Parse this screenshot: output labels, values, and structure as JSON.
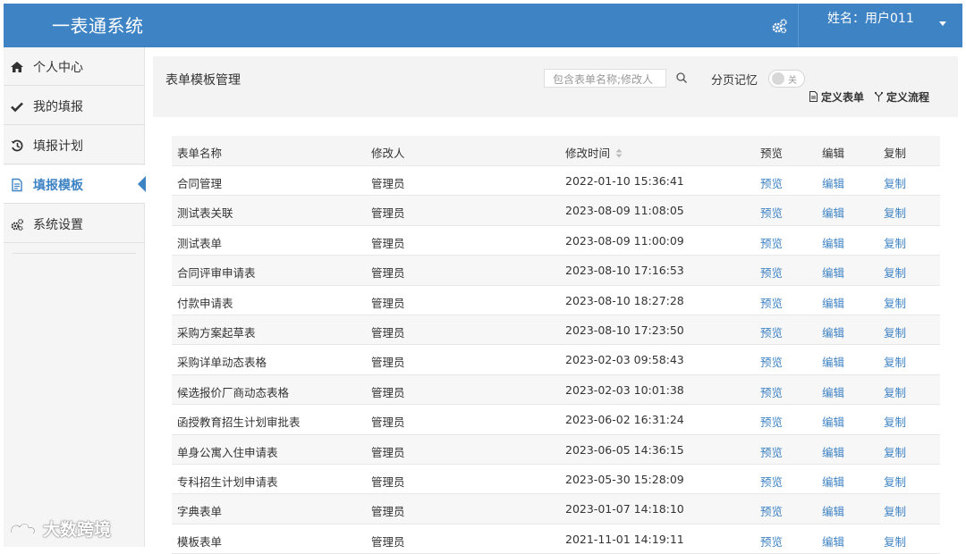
{
  "header": {
    "app_title": "一表通系统",
    "user_label": "姓名：用户011"
  },
  "sidebar": {
    "items": [
      {
        "label": "个人中心",
        "icon": "home-icon"
      },
      {
        "label": "我的填报",
        "icon": "check-icon"
      },
      {
        "label": "填报计划",
        "icon": "history-icon"
      },
      {
        "label": "填报模板",
        "icon": "document-icon",
        "active": true
      },
      {
        "label": "系统设置",
        "icon": "gears-icon"
      }
    ]
  },
  "toolbar": {
    "page_title": "表单模板管理",
    "search_placeholder": "包含表单名称;修改人",
    "page_memory_label": "分页记忆",
    "toggle_text": "关",
    "define_form": "定义表单",
    "define_flow": "定义流程"
  },
  "table": {
    "headers": {
      "name": "表单名称",
      "modifier": "修改人",
      "time": "修改时间",
      "preview": "预览",
      "edit": "编辑",
      "copy": "复制"
    },
    "action_labels": {
      "preview": "预览",
      "edit": "编辑",
      "copy": "复制"
    },
    "rows": [
      {
        "name": "合同管理",
        "modifier": "管理员",
        "time": "2022-01-10 15:36:41"
      },
      {
        "name": "测试表关联",
        "modifier": "管理员",
        "time": "2023-08-09 11:08:05"
      },
      {
        "name": "测试表单",
        "modifier": "管理员",
        "time": "2023-08-09 11:00:09"
      },
      {
        "name": "合同评审申请表",
        "modifier": "管理员",
        "time": "2023-08-10 17:16:53"
      },
      {
        "name": "付款申请表",
        "modifier": "管理员",
        "time": "2023-08-10 18:27:28"
      },
      {
        "name": "采购方案起草表",
        "modifier": "管理员",
        "time": "2023-08-10 17:23:50"
      },
      {
        "name": "采购详单动态表格",
        "modifier": "管理员",
        "time": "2023-02-03 09:58:43"
      },
      {
        "name": "候选报价厂商动态表格",
        "modifier": "管理员",
        "time": "2023-02-03 10:01:38"
      },
      {
        "name": "函授教育招生计划审批表",
        "modifier": "管理员",
        "time": "2023-06-02 16:31:24"
      },
      {
        "name": "单身公寓入住申请表",
        "modifier": "管理员",
        "time": "2023-06-05 14:36:15"
      },
      {
        "name": "专科招生计划申请表",
        "modifier": "管理员",
        "time": "2023-05-30 15:28:09"
      },
      {
        "name": "字典表单",
        "modifier": "管理员",
        "time": "2023-01-07 14:18:10"
      },
      {
        "name": "模板表单",
        "modifier": "管理员",
        "time": "2021-11-01 14:19:11"
      }
    ]
  },
  "watermark": {
    "text": "大数跨境"
  },
  "colors": {
    "accent": "#3e83c4",
    "topbar": "#3e83c4",
    "sidebar_bg": "#f5f5f5",
    "link": "#3e83c4"
  }
}
